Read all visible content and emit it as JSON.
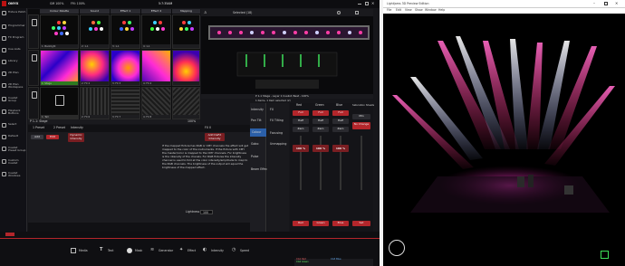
{
  "onyx": {
    "logo": "ONYX",
    "topbar": {
      "gm": "GM 100%",
      "fm": "FM: 100%",
      "time": "5:7:35AM"
    },
    "nav": [
      {
        "label": "Fixture\nPatch"
      },
      {
        "label": "Programmer"
      },
      {
        "label": "FX Program"
      },
      {
        "label": "Cue\nLists"
      },
      {
        "label": "Library"
      },
      {
        "label": "2D Plan"
      },
      {
        "label": "2D Plan\nWorkspace"
      },
      {
        "label": "Cuelist\nGroup"
      },
      {
        "label": "Playback\nButtons"
      },
      {
        "label": "Select"
      },
      {
        "label": "Default"
      },
      {
        "label": "Cuelist\nPreset Group"
      },
      {
        "label": "Custom\nCuelist"
      },
      {
        "label": "Cuelist\nWindows"
      }
    ],
    "grid": {
      "headers": [
        "Colour Palette",
        "Sound",
        "Effect 1",
        "Effect 2",
        "Mapping"
      ],
      "row_labels": [
        "Backlight 1",
        "Stage",
        "Tall rig 3"
      ],
      "cells_row1": [
        "1: Backlight",
        "2: 1-1",
        "3: 1-1",
        "4: 1-1"
      ],
      "cells_row2": [
        "1: Stage",
        "2: FX 2",
        "3: FX 3",
        "4: FX 4"
      ],
      "cells_row3": [
        "1: Tall",
        "2: FX 6",
        "3: FX 7",
        "4: FX 8"
      ],
      "status_left": "P 1-1: Stage",
      "status_right": "100%"
    },
    "stage": {
      "title": "Selected (18)",
      "status": "P 1-1  Stage - Layer 1  Cuelist: Beat - 100%",
      "status2": "1 items, 1 item selected (2)"
    },
    "mid": {
      "tabs": [
        "1 Preset",
        "2 Preset",
        "Intensity"
      ],
      "buttons": [
        "Add",
        "Edit",
        "Dynamic\nIntensity"
      ],
      "fx_label": "FX 0",
      "add_button": "Add DeFX\nIntensity",
      "help_text": "If the mapped fixture has RGB or CMY channels the effect will get mapped to the color of the instruments. If the fixture with CMY the master/color is mapped to the CMY channels. For brightness is the intensity of the chanels. For RGB fixtures the intensity channel is used to fold at the color intensity/amplitude to map to the RGB channels. The brightness of the output will equal the brightness of the mapped effect.",
      "inputs": [
        "Lightness",
        "100"
      ]
    },
    "bottom": {
      "items": [
        "Media",
        "Text",
        "Mask",
        "Generator",
        "Effect",
        "Intensity",
        "Speed"
      ]
    },
    "attr_tabs": [
      "Intensity",
      "FX",
      "Pan Tilt",
      "Colour",
      "Beam",
      "Gobo",
      "Beam Effects"
    ],
    "attr_tab_items": [
      "Intensity",
      "FX",
      "Pan Tilt",
      "FX Tilting",
      "Gobo",
      "Focusing",
      "Colour",
      "Unmapping",
      "Pulse"
    ],
    "faders": {
      "headers": [
        "Red",
        "Green",
        "Blue",
        "Saturation\nSheets"
      ],
      "columns": [
        {
          "name": "Red",
          "top": "Full",
          "mid": "Half",
          "low": "Zero",
          "val": "100 %",
          "bottom": "Red"
        },
        {
          "name": "Green",
          "top": "Full",
          "mid": "Half",
          "low": "Zero",
          "val": "100 %",
          "bottom": "Green"
        },
        {
          "name": "Blue",
          "top": "Full",
          "mid": "Half",
          "low": "Zero",
          "val": "100 %",
          "bottom": "Blue"
        },
        {
          "name": "Sat",
          "top": "Min",
          "mid": "No\nChange",
          "low": "Zero",
          "val": "",
          "bottom": "Sat"
        }
      ],
      "right_col": [
        "Min",
        "No Change",
        "Saturation",
        "Sheets"
      ]
    },
    "footer_rows": [
      "CG1 Red",
      "CG2 Green",
      "CG3 Blue"
    ]
  },
  "preview": {
    "title": "Lightjams 3D Preview Edition",
    "menu": [
      "File",
      "Edit",
      "View",
      "Show",
      "Window",
      "Help"
    ]
  },
  "colors": {
    "red_accent": "#d0262b",
    "onyx_bg": "#16161a",
    "beam": "#ff3da6"
  }
}
